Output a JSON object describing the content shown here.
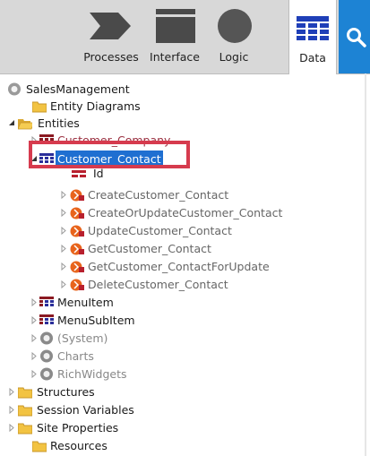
{
  "toolbar": {
    "processes_label": "Processes",
    "interface_label": "Interface",
    "logic_label": "Logic",
    "data_label": "Data"
  },
  "tree": {
    "root": "SalesManagement",
    "entity_diagrams": "Entity Diagrams",
    "entities": "Entities",
    "customer_company": "Customer_Company",
    "customer_contact": "Customer_Contact",
    "id_attr": "Id",
    "actions": [
      "CreateCustomer_Contact",
      "CreateOrUpdateCustomer_Contact",
      "UpdateCustomer_Contact",
      "GetCustomer_Contact",
      "GetCustomer_ContactForUpdate",
      "DeleteCustomer_Contact"
    ],
    "menu_item": "MenuItem",
    "menu_sub_item": "MenuSubItem",
    "system": "(System)",
    "charts": "Charts",
    "rich_widgets": "RichWidgets",
    "structures": "Structures",
    "session_variables": "Session Variables",
    "site_properties": "Site Properties",
    "resources": "Resources"
  },
  "colors": {
    "selection": "#1f6fd1",
    "highlight_border": "#d63b4e",
    "entity_icon": "#2b2f9a",
    "action_icon": "#e8641c",
    "folder": "#f2c342",
    "accent_search": "#1d83d4"
  }
}
